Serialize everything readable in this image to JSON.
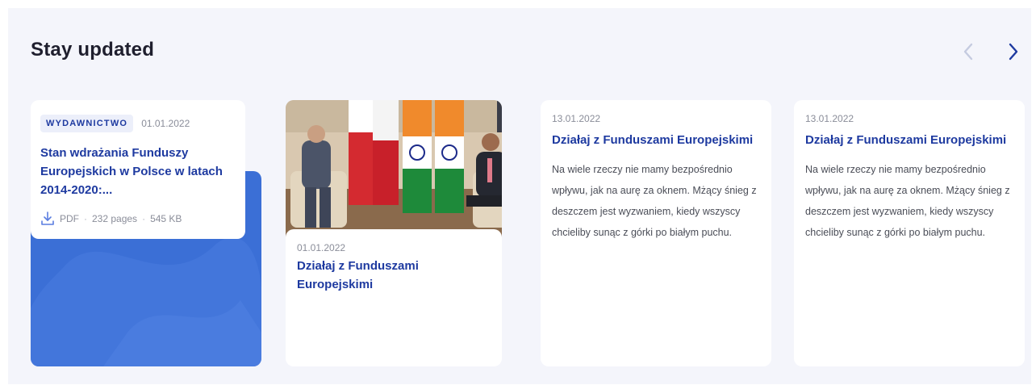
{
  "section": {
    "title": "Stay updated"
  },
  "navigation": {
    "prev_icon": "chevron-left-icon",
    "next_icon": "chevron-right-icon"
  },
  "cards": [
    {
      "type": "publication",
      "badge": "WYDAWNICTWO",
      "date": "01.01.2022",
      "title": "Stan wdrażania Funduszy Europejskich w Polsce w latach 2014-2020:...",
      "file_type": "PDF",
      "pages": "232 pages",
      "size": "545 KB",
      "icon": "download-icon"
    },
    {
      "type": "image",
      "date": "01.01.2022",
      "title": "Działaj z Funduszami Europejskimi",
      "image": "photo-meeting-flags"
    },
    {
      "type": "text",
      "date": "13.01.2022",
      "title": "Działaj z Funduszami Europejskimi",
      "excerpt": "Na wiele rzeczy nie mamy bezpośrednio wpływu, jak na aurę za oknem. Mżący śnieg z deszczem jest wyzwaniem, kiedy wszyscy chcieliby sunąc z górki po białym puchu."
    },
    {
      "type": "text",
      "date": "13.01.2022",
      "title": "Działaj z Funduszami Europejskimi",
      "excerpt": "Na wiele rzeczy nie mamy bezpośrednio wpływu, jak na aurę za oknem. Mżący śnieg z deszczem jest wyzwaniem, kiedy wszyscy chcieliby sunąc z górki po białym puchu."
    }
  ],
  "colors": {
    "accent": "#1e3aa0",
    "card_blue": "#3b6fd6",
    "background": "#f4f5fb"
  }
}
